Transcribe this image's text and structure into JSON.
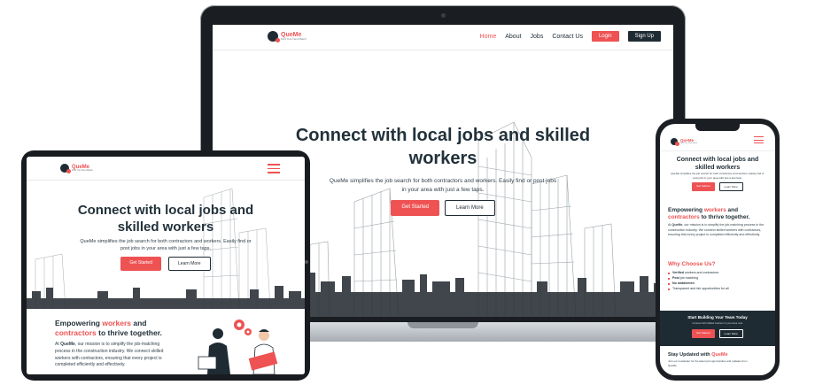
{
  "brand": {
    "name": "QueMe",
    "tagline": "Find Your Next Match"
  },
  "colors": {
    "accent": "#ee5253",
    "dark": "#1f2b33",
    "text": "#22313a"
  },
  "nav": {
    "links": [
      "Home",
      "About",
      "Jobs",
      "Contact Us"
    ],
    "login": "Login",
    "signup": "Sign Up"
  },
  "hero": {
    "title": "Connect with local jobs and skilled workers",
    "subtitle": "QueMe simplifies the job search for both contractors and workers. Easily find or post jobs in your area with just a few taps.",
    "primary_button": "Get Started",
    "secondary_button": "Learn More"
  },
  "empowering": {
    "title_pre": "Empowering ",
    "title_w1": "workers",
    "title_mid": " and",
    "title_w2": "contractors",
    "title_post": " to thrive together.",
    "brand_bold": "QueMe",
    "body_pre": "At ",
    "body_post": ", our mission is to simplify the job-matching process in the construction industry. We connect skilled workers with contractors, ensuring that every project is completed efficiently and effectively."
  },
  "why": {
    "title": "Why Choose Us?",
    "items": [
      {
        "bold": "Verified",
        "rest": " workers and contractors"
      },
      {
        "bold": "Post",
        "rest": " job matching"
      },
      {
        "bold": "No middlemen",
        "rest": ""
      },
      {
        "bold": "",
        "rest": "Transparent and fair opportunities for all"
      }
    ]
  },
  "cta": {
    "title": "Start Building Your Team Today",
    "subtitle": "Connect with skilled workers in your area now.",
    "primary": "Get Started",
    "secondary": "Learn More"
  },
  "newsletter": {
    "title_pre": "Stay Updated with ",
    "title_brand": "QueMe",
    "subtitle": "Join our newsletter for the latest job opportunities and updates from QueMe."
  },
  "icons": [
    "menu-icon",
    "gear-icon",
    "logo-icon"
  ]
}
